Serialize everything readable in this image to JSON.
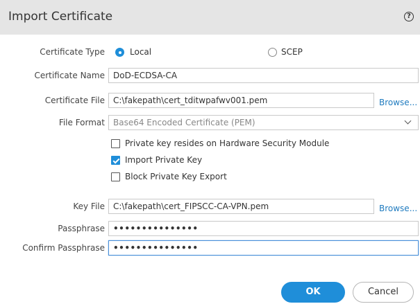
{
  "dialog": {
    "title": "Import Certificate",
    "help_icon": "?"
  },
  "form": {
    "certificate_type": {
      "label": "Certificate Type",
      "options": [
        {
          "label": "Local",
          "selected": true
        },
        {
          "label": "SCEP",
          "selected": false
        }
      ]
    },
    "certificate_name": {
      "label": "Certificate Name",
      "value": "DoD-ECDSA-CA"
    },
    "certificate_file": {
      "label": "Certificate File",
      "value": "C:\\fakepath\\cert_tditwpafwv001.pem",
      "browse_label": "Browse..."
    },
    "file_format": {
      "label": "File Format",
      "value": "Base64 Encoded Certificate (PEM)"
    },
    "checkboxes": [
      {
        "label": "Private key resides on Hardware Security Module",
        "checked": false
      },
      {
        "label": "Import Private Key",
        "checked": true
      },
      {
        "label": "Block Private Key Export",
        "checked": false
      }
    ],
    "key_file": {
      "label": "Key File",
      "value": "C:\\fakepath\\cert_FIPSCC-CA-VPN.pem",
      "browse_label": "Browse..."
    },
    "passphrase": {
      "label": "Passphrase",
      "value": "•••••••••••••••"
    },
    "confirm_passphrase": {
      "label": "Confirm Passphrase",
      "value": "•••••••••••••••"
    }
  },
  "buttons": {
    "ok_label": "OK",
    "cancel_label": "Cancel"
  },
  "colors": {
    "accent": "#1f8ed9",
    "link": "#1f7bbf",
    "header_bg": "#e5e5e5"
  }
}
